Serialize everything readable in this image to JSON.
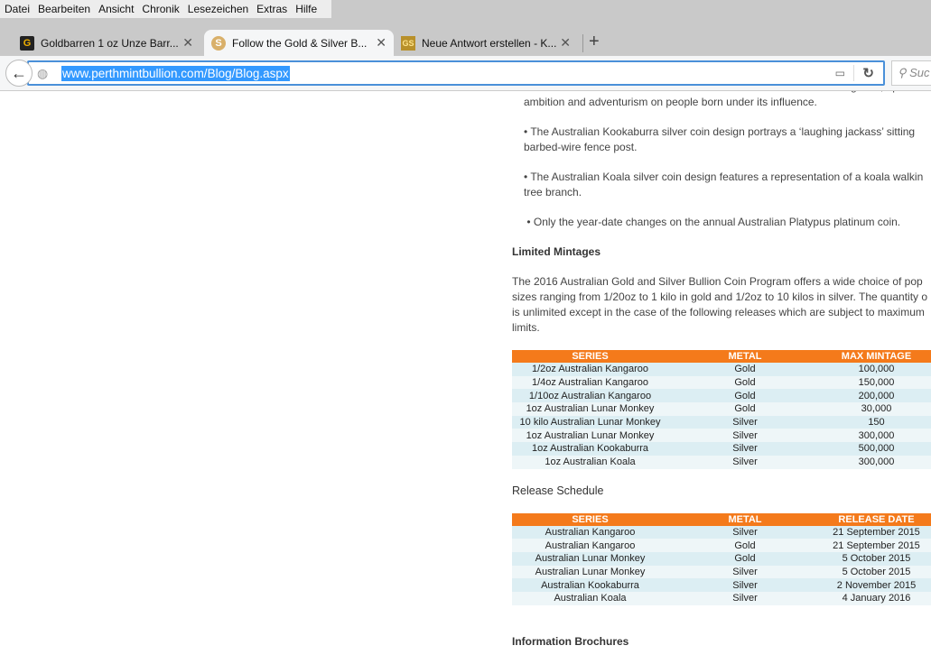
{
  "menu": [
    "Datei",
    "Bearbeiten",
    "Ansicht",
    "Chronik",
    "Lesezeichen",
    "Extras",
    "Hilfe"
  ],
  "tabs": [
    {
      "label": "Goldbarren 1 oz Unze Barr...",
      "icon": "G"
    },
    {
      "label": "Follow the Gold & Silver B...",
      "icon": "S"
    },
    {
      "label": "Neue Antwort erstellen - K...",
      "icon": "GS"
    }
  ],
  "url": "www.perthmintbullion.com/Blog/Blog.aspx",
  "search_placeholder": "Suc",
  "content": {
    "clipped_line": "animal in the traditional Chinese Zodiac which is said to confer intelligence, optimism",
    "p1": "ambition and adventurism on people born under its influence.",
    "p2a": "• The Australian Kookaburra silver coin design portrays a ‘laughing jackass’ sitting",
    "p2b": "barbed-wire fence post.",
    "p3a": "• The Australian Koala silver coin design features a representation of a koala walkin",
    "p3b": "tree branch.",
    "p4": " • Only the year-date changes on the annual Australian Platypus platinum coin.",
    "h1": "Limited Mintages",
    "p5": [
      "The 2016 Australian Gold and Silver Bullion Coin Program offers a wide choice of pop",
      "sizes ranging from 1/20oz to 1 kilo in gold and 1/2oz to 10 kilos in silver. The quantity o",
      "is unlimited except in the case of the following releases which are subject to maximum",
      "limits."
    ],
    "h2": "Release Schedule",
    "h3": "Information Brochures"
  },
  "mintage_table": {
    "headers": [
      "SERIES",
      "METAL",
      "MAX MINTAGE"
    ],
    "rows": [
      [
        "1/2oz Australian Kangaroo",
        "Gold",
        "100,000"
      ],
      [
        "1/4oz Australian Kangaroo",
        "Gold",
        "150,000"
      ],
      [
        "1/10oz Australian Kangaroo",
        "Gold",
        "200,000"
      ],
      [
        "1oz Australian Lunar Monkey",
        "Gold",
        "30,000"
      ],
      [
        "10 kilo Australian Lunar Monkey",
        "Silver",
        "150"
      ],
      [
        "1oz Australian Lunar Monkey",
        "Silver",
        "300,000"
      ],
      [
        "1oz Australian Kookaburra",
        "Silver",
        "500,000"
      ],
      [
        "1oz Australian Koala",
        "Silver",
        "300,000"
      ]
    ]
  },
  "release_table": {
    "headers": [
      "SERIES",
      "METAL",
      "RELEASE DATE"
    ],
    "rows": [
      [
        "Australian Kangaroo",
        "Silver",
        "21 September 2015"
      ],
      [
        "Australian Kangaroo",
        "Gold",
        "21 September 2015"
      ],
      [
        "Australian Lunar Monkey",
        "Gold",
        "5 October 2015"
      ],
      [
        "Australian Lunar Monkey",
        "Silver",
        "5 October 2015"
      ],
      [
        "Australian Kookaburra",
        "Silver",
        "2 November 2015"
      ],
      [
        "Australian Koala",
        "Silver",
        "4 January 2016"
      ]
    ]
  }
}
